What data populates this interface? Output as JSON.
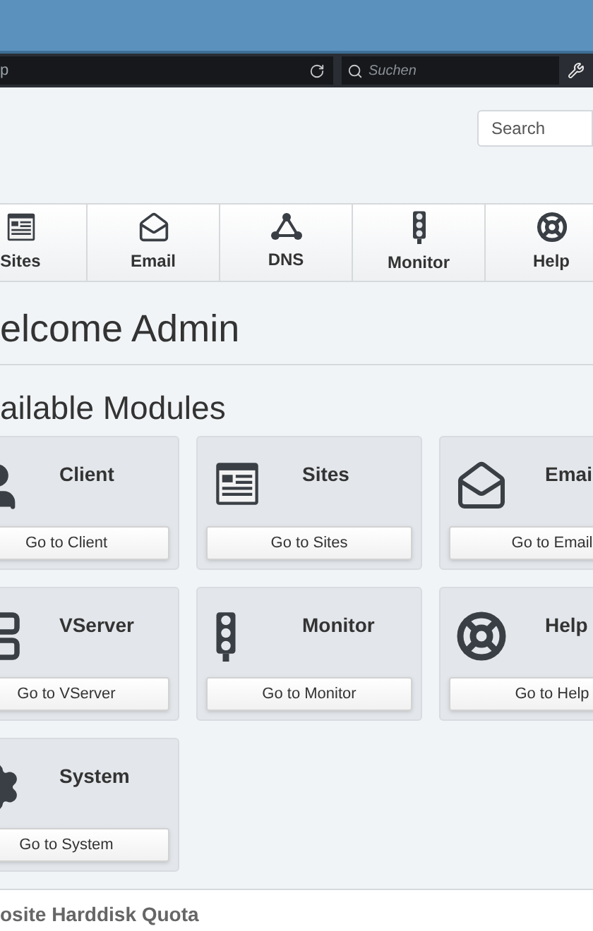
{
  "browser": {
    "address_fragment": "p",
    "search_placeholder": "Suchen"
  },
  "search": {
    "placeholder": "Search"
  },
  "nav": [
    {
      "label": "Sites"
    },
    {
      "label": "Email"
    },
    {
      "label": "DNS"
    },
    {
      "label": "Monitor"
    },
    {
      "label": "Help"
    }
  ],
  "welcome": "elcome Admin",
  "modules_heading": "ailable Modules",
  "modules": [
    {
      "title": "Client",
      "button": "Go to Client"
    },
    {
      "title": "Sites",
      "button": "Go to Sites"
    },
    {
      "title": "Emai",
      "button": "Go to Email"
    },
    {
      "title": "VServer",
      "button": "Go to VServer"
    },
    {
      "title": "Monitor",
      "button": "Go to Monitor"
    },
    {
      "title": "Help",
      "button": "Go to Help"
    },
    {
      "title": "System",
      "button": "Go to System"
    }
  ],
  "bottom_panel": {
    "title": "osite Harddisk Quota"
  }
}
